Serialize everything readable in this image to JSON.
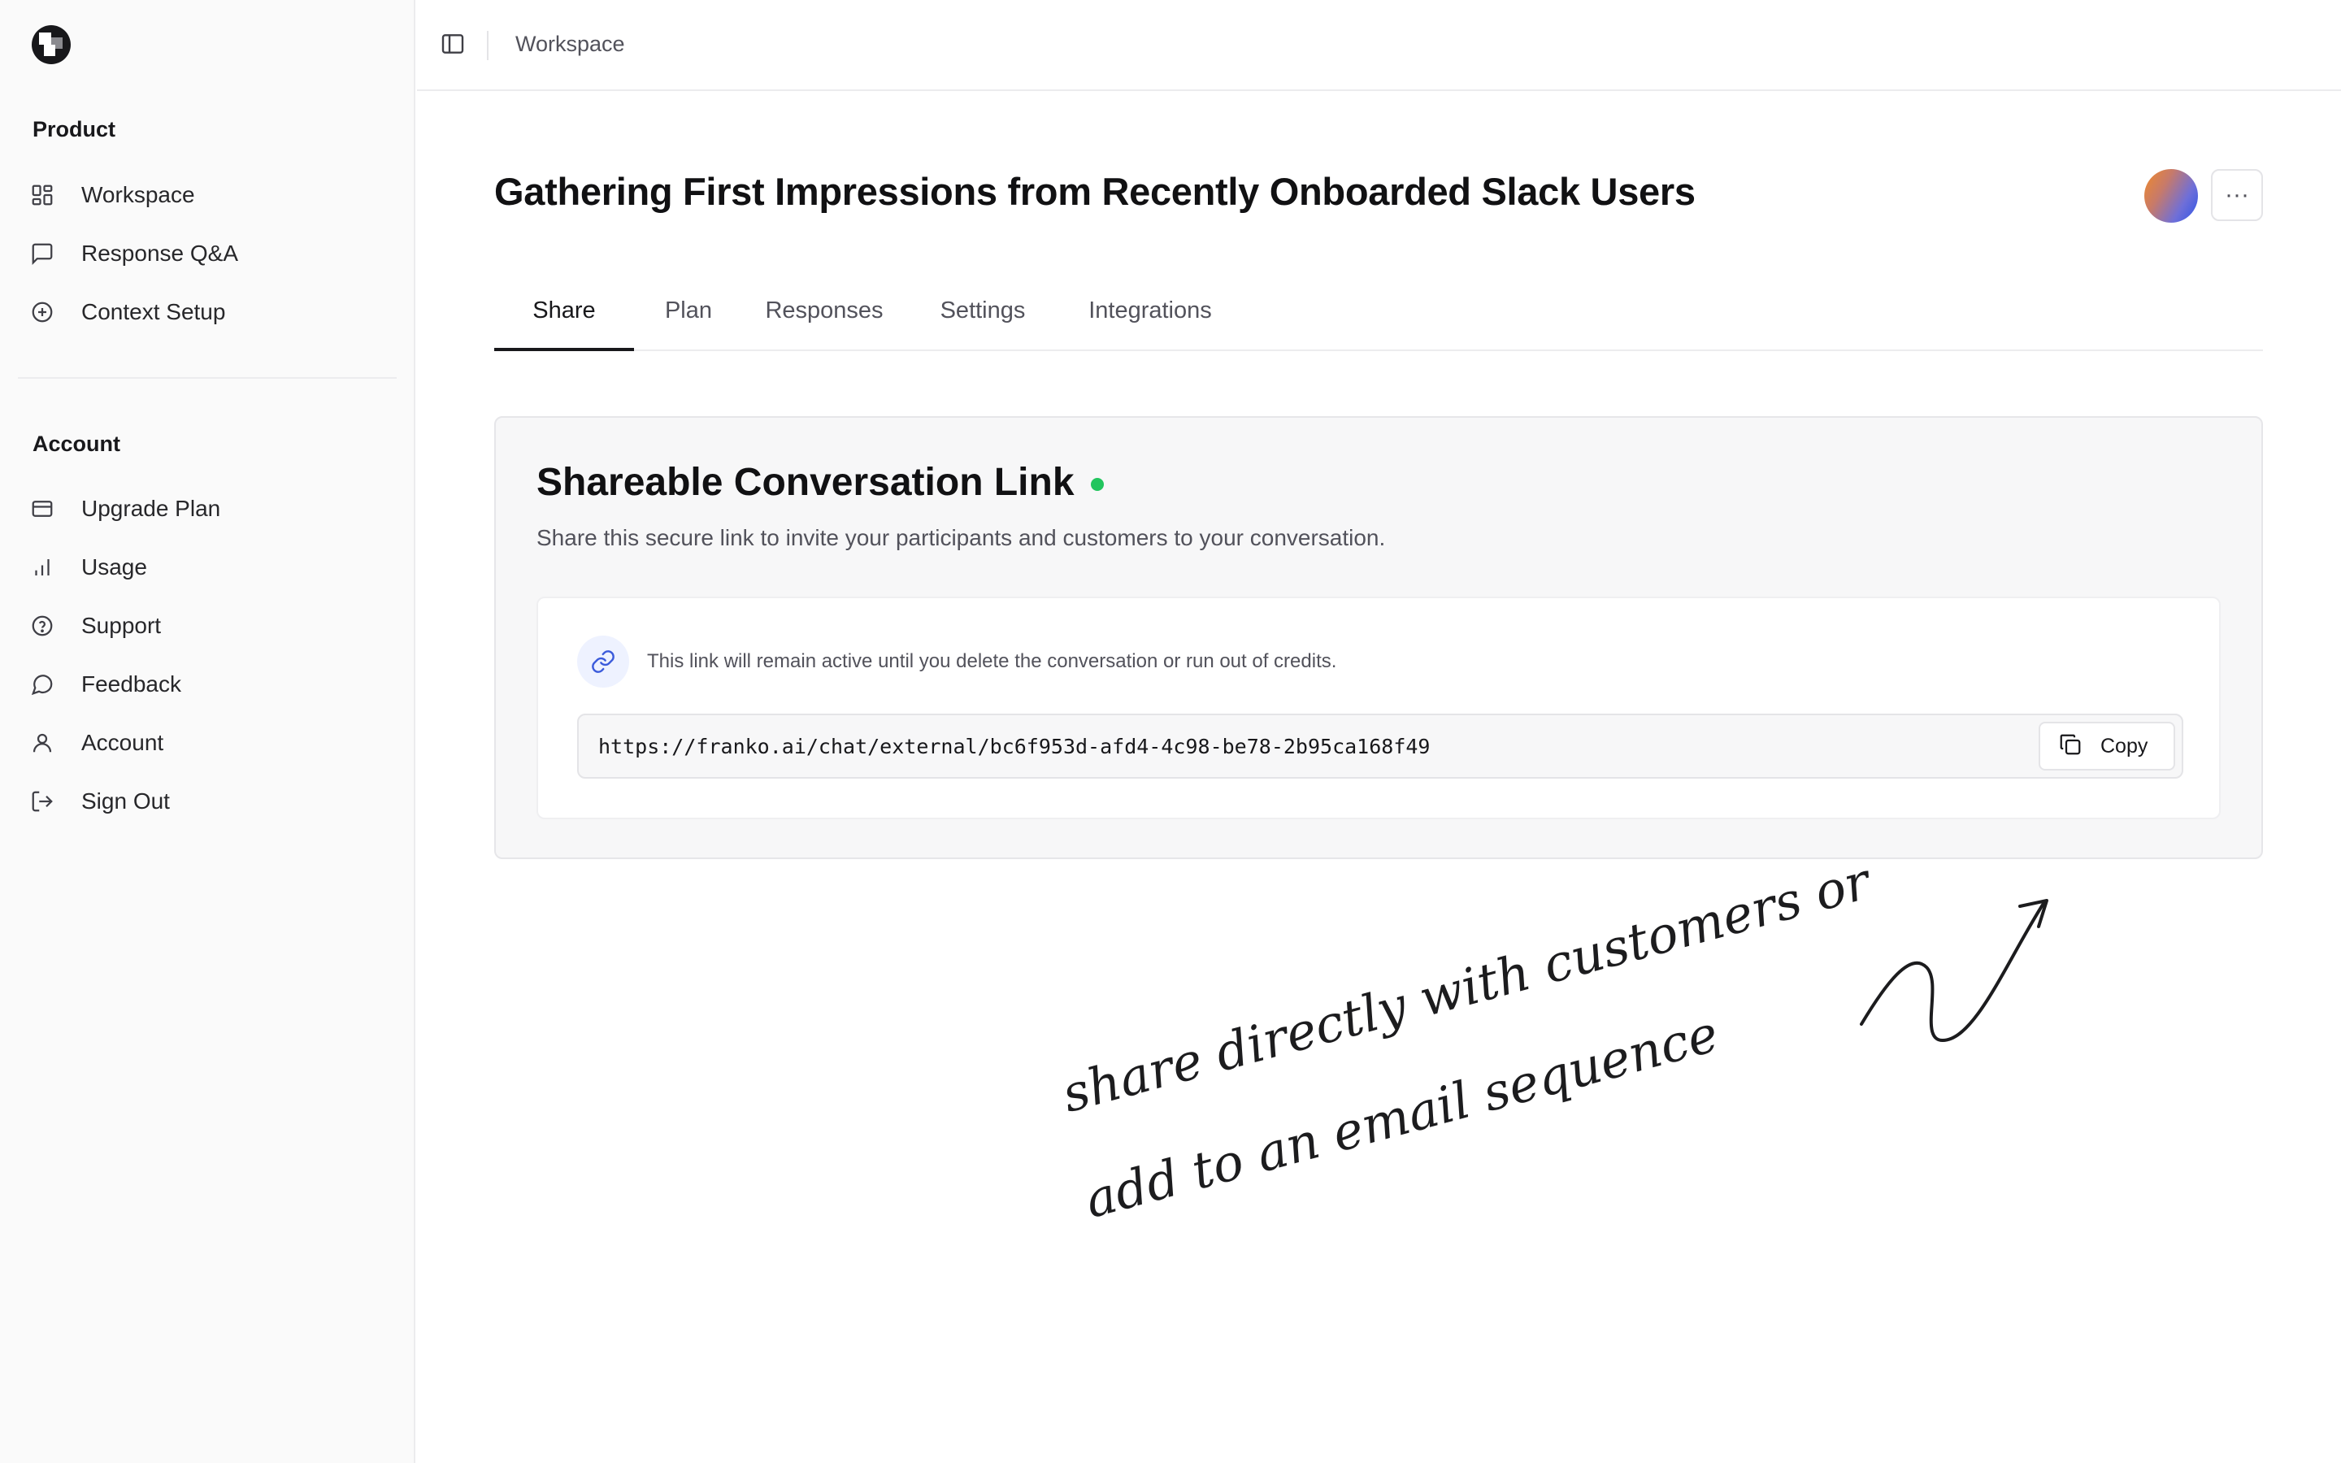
{
  "sidebar": {
    "product_title": "Product",
    "product_items": [
      {
        "label": "Workspace",
        "icon": "grid-icon"
      },
      {
        "label": "Response Q&A",
        "icon": "message-square-icon"
      },
      {
        "label": "Context Setup",
        "icon": "plus-circle-icon"
      }
    ],
    "account_title": "Account",
    "account_items": [
      {
        "label": "Upgrade Plan",
        "icon": "credit-card-icon"
      },
      {
        "label": "Usage",
        "icon": "bar-chart-icon"
      },
      {
        "label": "Support",
        "icon": "help-circle-icon"
      },
      {
        "label": "Feedback",
        "icon": "message-circle-icon"
      },
      {
        "label": "Account",
        "icon": "user-icon"
      },
      {
        "label": "Sign Out",
        "icon": "log-out-icon"
      }
    ]
  },
  "topbar": {
    "breadcrumb": "Workspace"
  },
  "header": {
    "title": "Gathering First Impressions from Recently Onboarded Slack Users",
    "more_label": "···"
  },
  "tabs": [
    {
      "label": "Share",
      "active": true
    },
    {
      "label": "Plan",
      "active": false
    },
    {
      "label": "Responses",
      "active": false
    },
    {
      "label": "Settings",
      "active": false
    },
    {
      "label": "Integrations",
      "active": false
    }
  ],
  "share_card": {
    "title": "Shareable Conversation Link",
    "description": "Share this secure link to invite your participants and customers to your conversation.",
    "notice": "This link will remain active until you delete the conversation or run out of credits.",
    "url": "https://franko.ai/chat/external/bc6f953d-afd4-4c98-be78-2b95ca168f49",
    "copy_label": "Copy",
    "status_color": "#22c55e"
  },
  "annotation": {
    "line1": "share directly with customers or",
    "line2": "add to an email sequence"
  }
}
